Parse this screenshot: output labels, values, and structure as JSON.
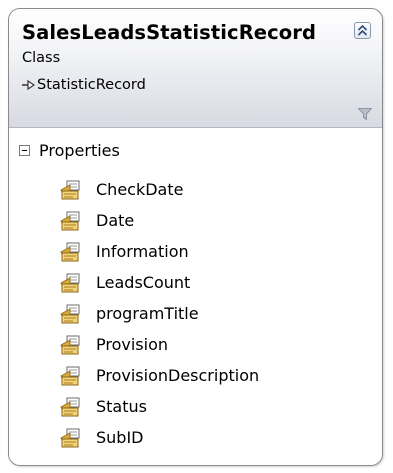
{
  "class": {
    "name": "SalesLeadsStatisticRecord",
    "stereotype": "Class",
    "base_class": "StatisticRecord"
  },
  "compartment": {
    "title": "Properties",
    "items": [
      {
        "label": "CheckDate",
        "icon": "property-icon"
      },
      {
        "label": "Date",
        "icon": "property-icon"
      },
      {
        "label": "Information",
        "icon": "property-icon"
      },
      {
        "label": "LeadsCount",
        "icon": "property-icon"
      },
      {
        "label": "programTitle",
        "icon": "property-icon"
      },
      {
        "label": "Provision",
        "icon": "property-icon"
      },
      {
        "label": "ProvisionDescription",
        "icon": "property-icon"
      },
      {
        "label": "Status",
        "icon": "property-icon"
      },
      {
        "label": "SubID",
        "icon": "property-icon"
      }
    ]
  },
  "colors": {
    "border": "#8a8a8a",
    "header_gradient_top": "#ffffff",
    "header_gradient_bottom": "#d7dae2",
    "text": "#000000"
  }
}
